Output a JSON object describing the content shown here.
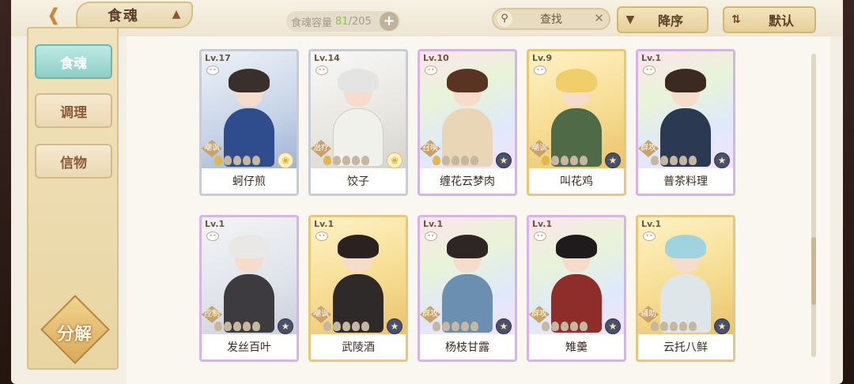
{
  "header": {
    "back_icon": "back-arrow-icon",
    "title": "食魂",
    "title_icon": "hat-icon",
    "capacity_label": "食魂容量",
    "capacity_current": "81",
    "capacity_total": "/205",
    "capacity_add": "+",
    "search_label": "查找",
    "search_clear": "✕",
    "sort_order_label": "降序",
    "sort_mode_label": "默认"
  },
  "sidebar": {
    "tabs": [
      {
        "label": "食魂",
        "active": true
      },
      {
        "label": "调理",
        "active": false
      },
      {
        "label": "信物",
        "active": false
      }
    ],
    "decompose_label": "分解"
  },
  "cards": [
    {
      "level": "Lv.17",
      "role": "嘲讽",
      "name": "蚵仔煎",
      "stars": 1,
      "element": "sun"
    },
    {
      "level": "Lv.14",
      "role": "治疗",
      "name": "饺子",
      "stars": 1,
      "element": "sun"
    },
    {
      "level": "Lv.10",
      "role": "召唤",
      "name": "缠花云梦肉",
      "stars": 1,
      "element": "moon"
    },
    {
      "level": "Lv.9",
      "role": "嘲讽",
      "name": "叫花鸡",
      "stars": 1,
      "element": "moon"
    },
    {
      "level": "Lv.1",
      "role": "群攻",
      "name": "普茶料理",
      "stars": 0,
      "element": "moon"
    },
    {
      "level": "Lv.1",
      "role": "控制",
      "name": "发丝百叶",
      "stars": 0,
      "element": "moon"
    },
    {
      "level": "Lv.1",
      "role": "嘲讽",
      "name": "武陵酒",
      "stars": 0,
      "element": "moon"
    },
    {
      "level": "Lv.1",
      "role": "群攻",
      "name": "杨枝甘露",
      "stars": 0,
      "element": "moon"
    },
    {
      "level": "Lv.1",
      "role": "群攻",
      "name": "雉羹",
      "stars": 0,
      "element": "moon"
    },
    {
      "level": "Lv.1",
      "role": "辅助",
      "name": "云托八鲜",
      "stars": 0,
      "element": "moon"
    }
  ],
  "colors": {
    "accent_teal": "#8ccfc7",
    "gold": "#e2b648",
    "capacity_current": "#8ec34a"
  }
}
